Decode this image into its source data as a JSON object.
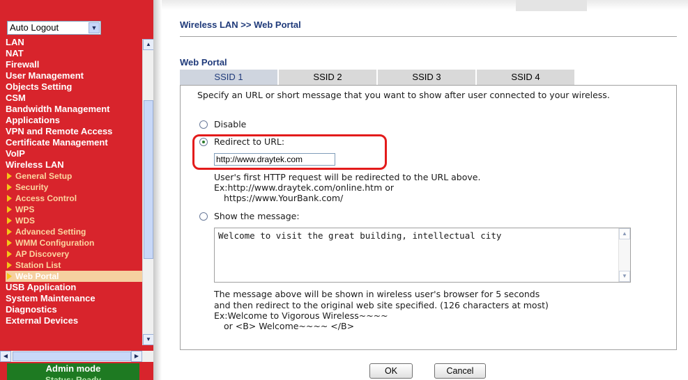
{
  "sidebar": {
    "logout_select": "Auto Logout",
    "menu": [
      {
        "label": "LAN",
        "type": "main"
      },
      {
        "label": "NAT",
        "type": "main"
      },
      {
        "label": "Firewall",
        "type": "main"
      },
      {
        "label": "User Management",
        "type": "main"
      },
      {
        "label": "Objects Setting",
        "type": "main"
      },
      {
        "label": "CSM",
        "type": "main"
      },
      {
        "label": "Bandwidth Management",
        "type": "main"
      },
      {
        "label": "Applications",
        "type": "main"
      },
      {
        "label": "VPN and Remote Access",
        "type": "main"
      },
      {
        "label": "Certificate Management",
        "type": "main"
      },
      {
        "label": "VoIP",
        "type": "main"
      },
      {
        "label": "Wireless LAN",
        "type": "main"
      },
      {
        "label": "General Setup",
        "type": "sub"
      },
      {
        "label": "Security",
        "type": "sub"
      },
      {
        "label": "Access Control",
        "type": "sub"
      },
      {
        "label": "WPS",
        "type": "sub"
      },
      {
        "label": "WDS",
        "type": "sub"
      },
      {
        "label": "Advanced Setting",
        "type": "sub"
      },
      {
        "label": "WMM Configuration",
        "type": "sub"
      },
      {
        "label": "AP Discovery",
        "type": "sub"
      },
      {
        "label": "Station List",
        "type": "sub"
      },
      {
        "label": "Web Portal",
        "type": "sub",
        "active": true
      },
      {
        "label": "USB Application",
        "type": "main"
      },
      {
        "label": "System Maintenance",
        "type": "main"
      },
      {
        "label": "Diagnostics",
        "type": "main"
      },
      {
        "label": "External Devices",
        "type": "main"
      }
    ],
    "admin_mode": "Admin mode",
    "status_text": "Status: Ready"
  },
  "main": {
    "breadcrumb": "Wireless LAN >> Web Portal",
    "section_title": "Web Portal",
    "tabs": [
      "SSID 1",
      "SSID 2",
      "SSID 3",
      "SSID 4"
    ],
    "active_tab": "SSID 1",
    "description": "Specify an URL or short message that you want to show after user connected to your wireless.",
    "options": {
      "disable_label": "Disable",
      "redirect_label": "Redirect to URL:",
      "url_value": "http://www.draytek.com",
      "redirect_note_1": "User's first HTTP request will be redirected to the URL above.",
      "redirect_note_2": "Ex:http://www.draytek.com/online.htm or",
      "redirect_note_3": "https://www.YourBank.com/",
      "message_label": "Show the message:",
      "message_value": "Welcome to visit the great building, intellectual city",
      "message_note_1": "The message above will be shown in wireless user's browser for 5 seconds",
      "message_note_2": "and then redirect to the original web site specified. (126 characters at most)",
      "message_note_3": "Ex:Welcome to Vigorous Wireless~~~~",
      "message_note_4": "or <B> Welcome~~~~ </B>",
      "selected": "redirect"
    },
    "ok_label": "OK",
    "cancel_label": "Cancel"
  },
  "colors": {
    "sidebar_bg": "#d8242c",
    "title_blue": "#1f3a7a",
    "highlight_red": "#e31b1b",
    "admin_green": "#1e7a22"
  }
}
